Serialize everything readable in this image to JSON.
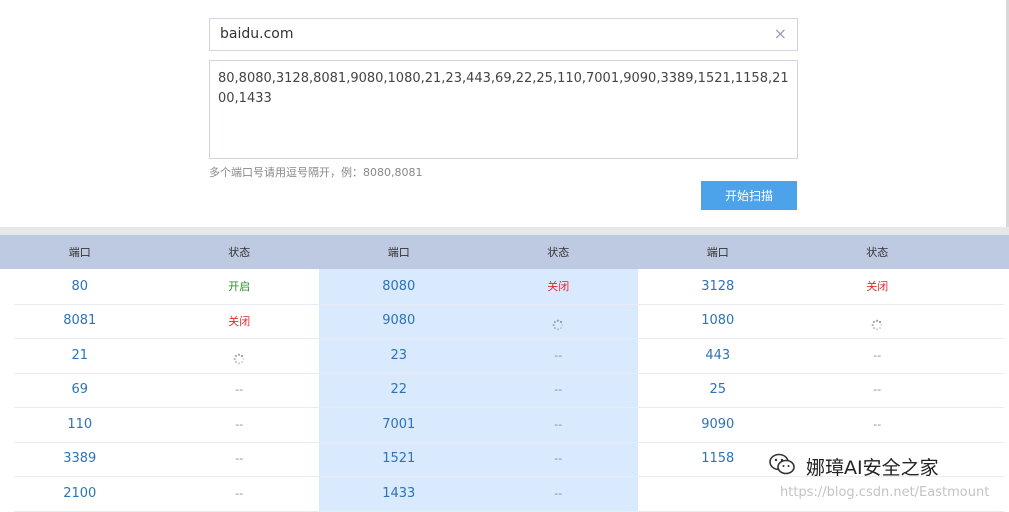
{
  "form": {
    "domain_value": "baidu.com",
    "ports_value": "80,8080,3128,8081,9080,1080,21,23,443,69,22,25,110,7001,9090,3389,1521,1158,2100,1433",
    "hint": "多个端口号请用逗号隔开，例：8080,8081",
    "scan_button": "开始扫描",
    "clear_icon": "×"
  },
  "table": {
    "headers": [
      "端口",
      "状态",
      "端口",
      "状态",
      "端口",
      "状态"
    ],
    "rows": [
      [
        {
          "port": "80",
          "status": "开启",
          "type": "open"
        },
        {
          "port": "8080",
          "status": "关闭",
          "type": "closed"
        },
        {
          "port": "3128",
          "status": "关闭",
          "type": "closed"
        }
      ],
      [
        {
          "port": "8081",
          "status": "关闭",
          "type": "closed"
        },
        {
          "port": "9080",
          "status": "",
          "type": "loading"
        },
        {
          "port": "1080",
          "status": "",
          "type": "loading"
        }
      ],
      [
        {
          "port": "21",
          "status": "",
          "type": "loading"
        },
        {
          "port": "23",
          "status": "--",
          "type": "none"
        },
        {
          "port": "443",
          "status": "--",
          "type": "none"
        }
      ],
      [
        {
          "port": "69",
          "status": "--",
          "type": "none"
        },
        {
          "port": "22",
          "status": "--",
          "type": "none"
        },
        {
          "port": "25",
          "status": "--",
          "type": "none"
        }
      ],
      [
        {
          "port": "110",
          "status": "--",
          "type": "none"
        },
        {
          "port": "7001",
          "status": "--",
          "type": "none"
        },
        {
          "port": "9090",
          "status": "--",
          "type": "none"
        }
      ],
      [
        {
          "port": "3389",
          "status": "--",
          "type": "none"
        },
        {
          "port": "1521",
          "status": "--",
          "type": "none"
        },
        {
          "port": "1158",
          "status": "",
          "type": "none"
        }
      ],
      [
        {
          "port": "2100",
          "status": "--",
          "type": "none"
        },
        {
          "port": "1433",
          "status": "--",
          "type": "none"
        },
        {
          "port": "",
          "status": "",
          "type": "none"
        }
      ]
    ]
  },
  "watermark": {
    "name": "娜璋AI安全之家",
    "url": "https://blog.csdn.net/Eastmount",
    "icon": "wechat-icon"
  },
  "colors": {
    "header_bg": "#bec9e2",
    "button_bg": "#4da3ea",
    "open": "#2f8f2f",
    "closed": "#e02a2a",
    "port": "#2d73b8"
  }
}
